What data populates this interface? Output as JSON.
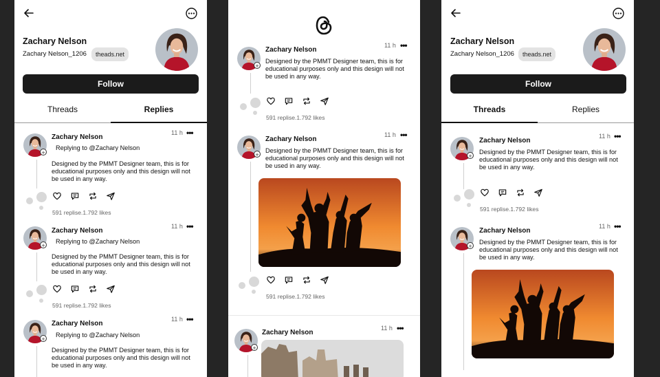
{
  "profile": {
    "name": "Zachary Nelson",
    "handle": "Zachary Nelson_1206",
    "badge": "theads.net",
    "follow_label": "Follow",
    "tabs": [
      "Threads",
      "Replies"
    ]
  },
  "posts": {
    "author": "Zachary Nelson",
    "time": "11 h",
    "more": "•••",
    "replying": "Replying to @Zachary Nelson",
    "body_line1": "Designed by the PMMT Designer team, this is for",
    "body_line2": "educational purposes only and this design will not",
    "body_line3": "be used in any way.",
    "stats_p1": "591 replise.1.792 likes",
    "stats_p2": "591 replise.1.792 likes"
  },
  "colors": {
    "background": "#252525",
    "button": "#1b1b1b",
    "badge_bg": "#e3e3e3",
    "sunset_top": "#c9582a",
    "sunset_mid": "#f08a30"
  },
  "icons": [
    "back-arrow-icon",
    "more-options-icon",
    "threads-logo-icon",
    "heart-icon",
    "comment-icon",
    "repost-icon",
    "share-icon"
  ]
}
